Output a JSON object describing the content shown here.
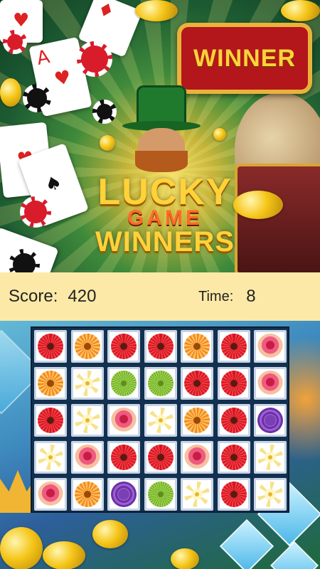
{
  "banner": {
    "sign_text": "WINNER",
    "logo_line1": "LUCKY",
    "logo_line2": "GAME",
    "logo_line3": "WINNERS"
  },
  "hud": {
    "score_label": "Score:",
    "score_value": "420",
    "time_label": "Time:",
    "time_value": "8"
  },
  "board": {
    "rows": [
      [
        "red",
        "orange",
        "red",
        "red",
        "orange",
        "red",
        "rose"
      ],
      [
        "orange",
        "yellow",
        "green",
        "green",
        "red",
        "red",
        "rose"
      ],
      [
        "red",
        "yellow",
        "rose",
        "yellow",
        "orange",
        "red",
        "purple"
      ],
      [
        "yellow",
        "rose",
        "red",
        "red",
        "rose",
        "red",
        "yellow"
      ],
      [
        "rose",
        "orange",
        "purple",
        "green",
        "yellow",
        "red",
        "yellow"
      ]
    ]
  },
  "colors": {
    "hud_background": "#fce9a7",
    "board_background": "#12304f",
    "sign_red": "#b3161b",
    "gold": "#ffd23a"
  }
}
